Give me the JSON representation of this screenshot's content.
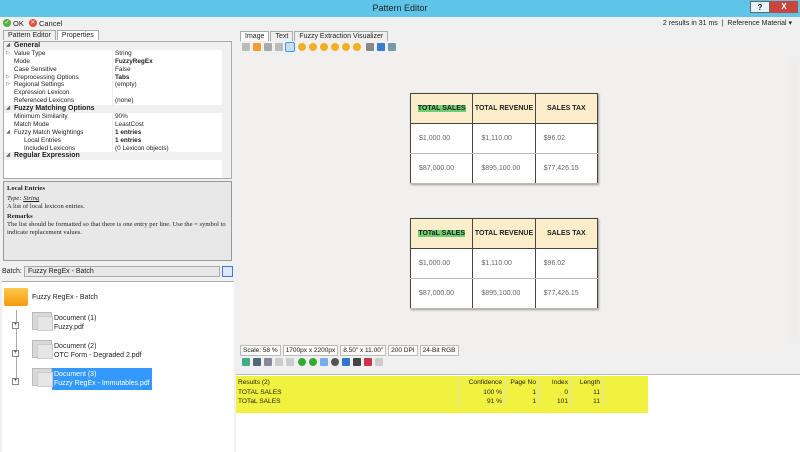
{
  "window": {
    "title": "Pattern Editor",
    "help": "?",
    "close": "X"
  },
  "topbar": {
    "ok": "OK",
    "cancel": "Cancel",
    "status": "2 results in 31 ms",
    "reference": "Reference Material"
  },
  "left_tabs": [
    "Pattern Editor",
    "Properties"
  ],
  "properties": [
    {
      "type": "cat",
      "key": "General"
    },
    {
      "exp": "▷",
      "key": "Value Type",
      "value": "String"
    },
    {
      "key": "Mode",
      "value": "FuzzyRegEx",
      "bold": true
    },
    {
      "key": "Case Sensitive",
      "value": "False"
    },
    {
      "exp": "▷",
      "key": "Preprocessing Options",
      "value": "Tabs",
      "bold": true
    },
    {
      "exp": "▷",
      "key": "Regional Settings",
      "value": "(empty)"
    },
    {
      "key": "Expression Lexicon",
      "value": ""
    },
    {
      "key": "Referenced Lexicons",
      "value": "(none)"
    },
    {
      "type": "cat",
      "key": "Fuzzy Matching Options"
    },
    {
      "key": "Minimum Similarity",
      "value": "90%"
    },
    {
      "key": "Match Mode",
      "value": "LeastCost"
    },
    {
      "exp": "◢",
      "key": "Fuzzy Match Weightings",
      "value": "1 entries",
      "bold": true
    },
    {
      "key": "Local Entries",
      "value": "1 entries",
      "bold": true,
      "indent": true
    },
    {
      "key": "Included Lexicons",
      "value": "(0 Lexicon objects)",
      "indent": true
    },
    {
      "type": "cat",
      "key": "Regular Expression"
    }
  ],
  "description": {
    "title": "Local Entries",
    "type_label": "Type:",
    "type_value": "String",
    "summary": "A list of local lexicon entries.",
    "remarks_title": "Remarks",
    "remarks": "The list should be formatted so that there is one entry per line. Use the = symbol to indicate replacement values."
  },
  "batch": {
    "label": "Batch:",
    "value": "Fuzzy RegEx - Batch",
    "root": "Fuzzy RegEx - Batch",
    "documents": [
      {
        "name": "Document (1)",
        "file": "Fuzzy.pdf"
      },
      {
        "name": "Document (2)",
        "file": "OTC Form - Degraded 2.pdf"
      },
      {
        "name": "Document (3)",
        "file": "Fuzzy RegEx - Immutables.pdf",
        "selected": true
      }
    ]
  },
  "right_tabs": [
    "Image",
    "Text",
    "Fuzzy Extraction Visualizer"
  ],
  "document_tables": [
    {
      "headers": [
        "TOTAL SALES",
        "TOTAL REVENUE",
        "SALES TAX"
      ],
      "rows": [
        [
          "$1,000.00",
          "$1,110.00",
          "$96.02"
        ],
        [
          "$87,000.00",
          "$895,100.00",
          "$77,426.15"
        ]
      ]
    },
    {
      "headers": [
        "TOTAL SALES",
        "TOTAL REVENUE",
        "SALES TAX"
      ],
      "header_display": "TOTaL SALES",
      "rows": [
        [
          "$1,000.00",
          "$1,110.00",
          "$96.02"
        ],
        [
          "$87,000.00",
          "$895,100.00",
          "$77,426.15"
        ]
      ]
    }
  ],
  "image_status": [
    "Scale: 58 %",
    "1700px x 2200px",
    "8.50\" x 11.00\"",
    "200 DPI",
    "24-Bit RGB"
  ],
  "results": {
    "columns": [
      "Results (2)",
      "Confidence",
      "Page No",
      "Index",
      "Length"
    ],
    "rows": [
      [
        "TOTAL SALES",
        "100 %",
        "1",
        "0",
        "11"
      ],
      [
        "TOTaL SALES",
        "91 %",
        "1",
        "101",
        "11"
      ]
    ]
  },
  "colors": {
    "titlebar": "#5ec5e9",
    "highlight": "#6fce6f",
    "results_highlight": "#efef2a",
    "selection": "#3399ff"
  }
}
